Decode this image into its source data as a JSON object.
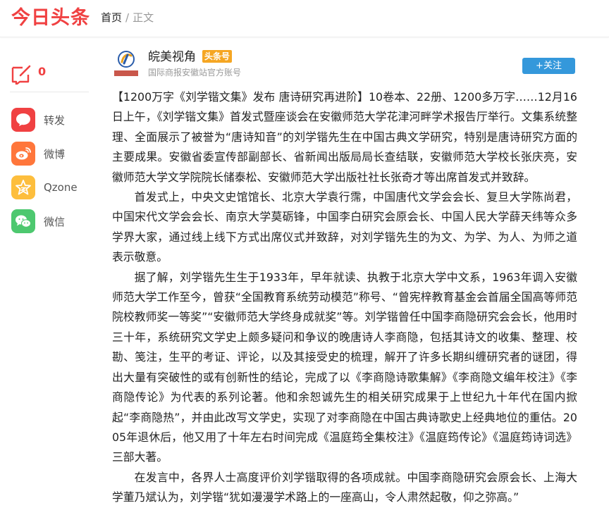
{
  "header": {
    "logo": "今日头条",
    "breadcrumb": {
      "home": "首页",
      "separator": "/",
      "current": "正文"
    }
  },
  "sidebar": {
    "comment_count": "0",
    "share": [
      {
        "label": "转发",
        "icon": "repost-icon",
        "color": "#f04142"
      },
      {
        "label": "微博",
        "icon": "weibo-icon",
        "color": "#ff763b"
      },
      {
        "label": "Qzone",
        "icon": "qzone-icon",
        "color": "#fdbe3d"
      },
      {
        "label": "微信",
        "icon": "wechat-icon",
        "color": "#4dc86f"
      }
    ]
  },
  "author": {
    "name": "皖美视角",
    "badge": "头条号",
    "description": "国际商报安徽站官方账号",
    "follow_label": "+关注",
    "colors": {
      "badge": "#f5a623",
      "follow": "#3498db"
    }
  },
  "article": {
    "paragraphs": [
      "【1200万字《刘学锴文集》发布  唐诗研究再进阶】10卷本、22册、1200多万字……12月16日上午，《刘学锴文集》首发式暨座谈会在安徽师范大学花津河畔学术报告厅举行。文集系统整理、全面展示了被誉为“唐诗知音”的刘学锴先生在中国古典文学研究，特别是唐诗研究方面的主要成果。安徽省委宣传部副部长、省新闻出版局局长查结联，安徽师范大学校长张庆亮，安徽师范大学文学院院长储泰松、安徽师范大学出版社社长张奇才等出席首发式并致辞。",
      "首发式上，中央文史馆馆长、北京大学袁行霈，中国唐代文学会会长、复旦大学陈尚君，中国宋代文学会会长、南京大学莫砺锋，中国李白研究会原会长、中国人民大学薛天纬等众多学界大家，通过线上线下方式出席仪式并致辞，对刘学锴先生的为文、为学、为人、为师之道表示敬意。",
      "据了解，刘学锴先生生于1933年，早年就读、执教于北京大学中文系，1963年调入安徽师范大学工作至今，曾获“全国教育系统劳动模范”称号、“曾宪梓教育基金会首届全国高等师范院校教师奖一等奖”“安徽师范大学终身成就奖”等。刘学锴曾任中国李商隐研究会会长，他用时三十年，系统研究文学史上颇多疑问和争议的晚唐诗人李商隐，包括其诗文的收集、整理、校勘、笺注，生平的考证、评论，以及其接受史的梳理，解开了许多长期纠缠研究者的谜团，得出大量有突破性的或有创新性的结论，完成了以《李商隐诗歌集解》《李商隐文编年校注》《李商隐传论》为代表的系列论著。他和余恕诚先生的相关研究成果于上世纪九十年代在国内掀起“李商隐热”，并由此改写文学史，实现了对李商隐在中国古典诗歌史上经典地位的重估。2005年退休后，他又用了十年左右时间完成《温庭筠全集校注》《温庭筠传论》《温庭筠诗词选》三部大著。",
      "在发言中，各界人士高度评价刘学锴取得的各项成就。中国李商隐研究会原会长、上海大学董乃斌认为，刘学锴“犹如漫漫学术路上的一座高山，令人肃然起敬，仰之弥高。”"
    ]
  },
  "colors": {
    "brand": "#f04142"
  }
}
